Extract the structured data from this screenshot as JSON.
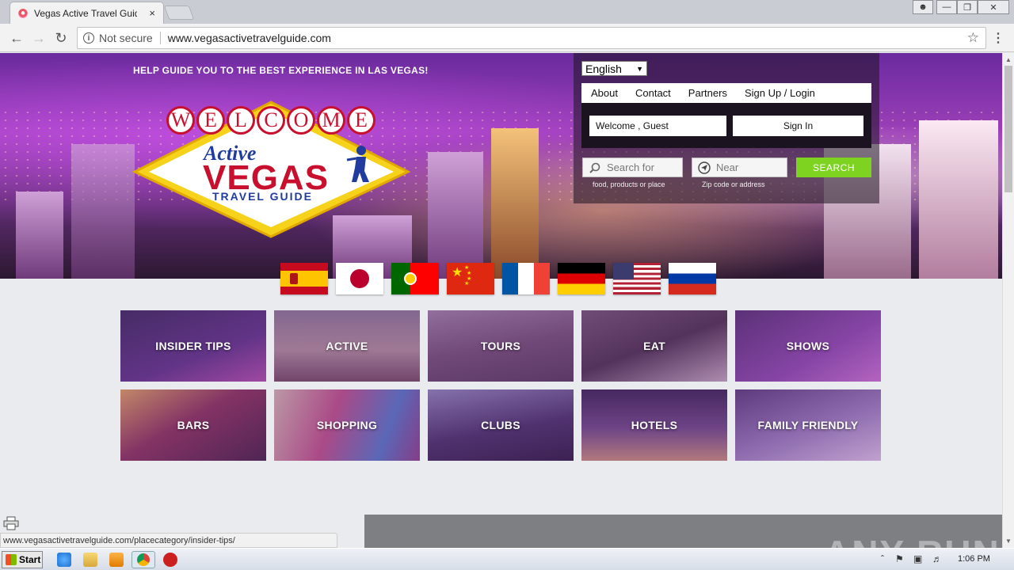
{
  "browser": {
    "tab_title": "Vegas Active Travel Guide |",
    "tab_close": "×",
    "security_label": "Not secure",
    "url": "www.vegasactivetravelguide.com",
    "status_url": "www.vegasactivetravelguide.com/placecategory/insider-tips/"
  },
  "site": {
    "tagline": "HELP GUIDE YOU TO THE BEST EXPERIENCE IN LAS VEGAS!",
    "logo": {
      "welcome_letters": [
        "W",
        "E",
        "L",
        "C",
        "O",
        "M",
        "E"
      ],
      "active": "Active",
      "vegas": "VEGAS",
      "travel_guide": "TRAVEL GUIDE"
    },
    "language": "English",
    "nav": [
      "About",
      "Contact",
      "Partners",
      "Sign Up / Login"
    ],
    "welcome_text": "Welcome , Guest",
    "sign_in": "Sign In",
    "search": {
      "search_placeholder": "Search for",
      "search_hint": "food, products or place",
      "near_placeholder": "Near",
      "near_hint": "Zip code or address",
      "button": "SEARCH"
    },
    "flags": [
      "spain",
      "japan",
      "portugal",
      "china",
      "france",
      "germany",
      "usa",
      "russia"
    ],
    "categories": [
      {
        "label": "INSIDER TIPS",
        "color": "#3b2a52"
      },
      {
        "label": "ACTIVE",
        "color": "#8b6f74"
      },
      {
        "label": "TOURS",
        "color": "#6e5866"
      },
      {
        "label": "EAT",
        "color": "#5a4752"
      },
      {
        "label": "SHOWS",
        "color": "#5e3a72"
      },
      {
        "label": "BARS",
        "color": "#7a3a4a"
      },
      {
        "label": "SHOPPING",
        "color": "#9b4d6b"
      },
      {
        "label": "CLUBS",
        "color": "#3a2e4c"
      },
      {
        "label": "HOTELS",
        "color": "#4a3557"
      },
      {
        "label": "FAMILY FRIENDLY",
        "color": "#7a6a8e"
      }
    ]
  },
  "taskbar": {
    "start": "Start",
    "clock": "1:06 PM"
  },
  "watermark": "ANY RUN"
}
